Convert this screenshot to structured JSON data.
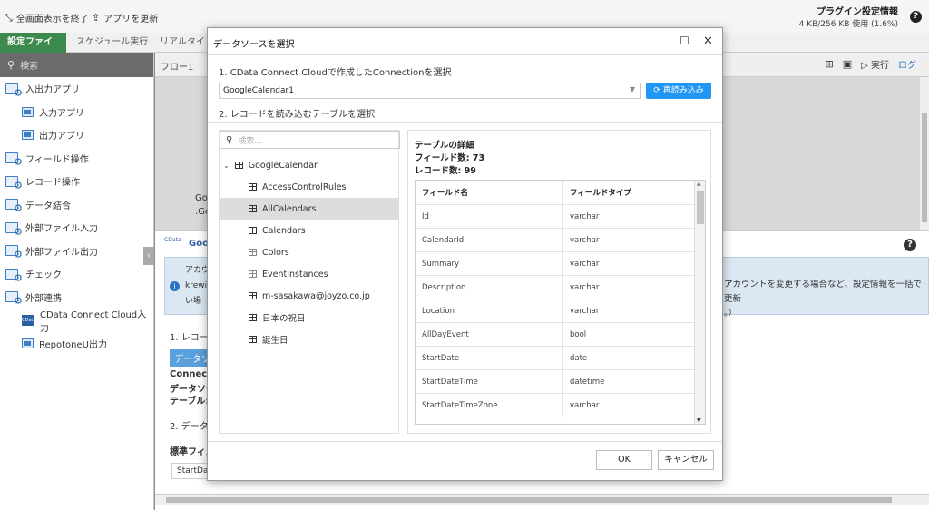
{
  "topbar": {
    "fullscreen_exit": "全画面表示を終了",
    "update_app": "アプリを更新",
    "plugin_title": "プラグイン設定情報",
    "plugin_usage": "4 KB/256 KB 使用 (1.6%)"
  },
  "tabs": [
    {
      "label": "設定ファイル"
    },
    {
      "label": "スケジュール実行"
    },
    {
      "label": "リアルタイム"
    }
  ],
  "sidebar": {
    "search_placeholder": "検索",
    "items": [
      {
        "label": "入出力アプリ",
        "kind": "group"
      },
      {
        "label": "入力アプリ",
        "kind": "app"
      },
      {
        "label": "出力アプリ",
        "kind": "app"
      },
      {
        "label": "フィールド操作",
        "kind": "group"
      },
      {
        "label": "レコード操作",
        "kind": "group"
      },
      {
        "label": "データ結合",
        "kind": "group"
      },
      {
        "label": "外部ファイル入力",
        "kind": "group"
      },
      {
        "label": "外部ファイル出力",
        "kind": "group"
      },
      {
        "label": "チェック",
        "kind": "group"
      },
      {
        "label": "外部連携",
        "kind": "group"
      },
      {
        "label": "CData Connect Cloud入力",
        "kind": "cdata"
      },
      {
        "label": "RepotoneU出力",
        "kind": "repo"
      }
    ]
  },
  "main": {
    "flow_label": "フロー1",
    "run_label": "実行",
    "log_label": "ログ",
    "frag_go1": "Go",
    "frag_go2": ".Go",
    "cdata_logo": "CData",
    "frag_goo": "Goo",
    "frag_acct": "アカウ",
    "frag_krew": "krewi",
    "frag_iba": "い場",
    "frag_step1": "1. レコー",
    "frag_ds": "データソ",
    "frag_conn": "Connectio",
    "frag_dsrc": "データソー",
    "frag_table": "テーブル:",
    "frag_step2": "2. データ",
    "frag_std": "標準フィル",
    "frag_startdate": "StartDa",
    "info_line1": "アカウントを変更する場合など、設定情報を一括で更新",
    "info_line2": "。）"
  },
  "dialog": {
    "title": "データソースを選択",
    "step1": "1. CData Connect Cloudで作成したConnectionを選択",
    "connection_value": "GoogleCalendar1",
    "reload_label": "再読み込み",
    "step2": "2. レコードを読み込むテーブルを選択",
    "search_placeholder": "検索...",
    "tree_root": "GoogleCalendar",
    "tree_items": [
      {
        "label": "AccessControlRules",
        "selected": false,
        "icon": "table-icon"
      },
      {
        "label": "AllCalendars",
        "selected": true,
        "icon": "table-icon"
      },
      {
        "label": "Calendars",
        "selected": false,
        "icon": "table-icon"
      },
      {
        "label": "Colors",
        "selected": false,
        "icon": "view-icon"
      },
      {
        "label": "EventInstances",
        "selected": false,
        "icon": "view-icon"
      },
      {
        "label": "m-sasakawa@joyzo.co.jp",
        "selected": false,
        "icon": "table-icon"
      },
      {
        "label": "日本の祝日",
        "selected": false,
        "icon": "table-icon"
      },
      {
        "label": "誕生日",
        "selected": false,
        "icon": "table-icon"
      }
    ],
    "detail_title": "テーブルの詳細",
    "field_count": "フィールド数: 73",
    "record_count": "レコード数: 99",
    "columns": [
      "フィールド名",
      "フィールドタイプ"
    ],
    "fields": [
      [
        "Id",
        "varchar"
      ],
      [
        "CalendarId",
        "varchar"
      ],
      [
        "Summary",
        "varchar"
      ],
      [
        "Description",
        "varchar"
      ],
      [
        "Location",
        "varchar"
      ],
      [
        "AllDayEvent",
        "bool"
      ],
      [
        "StartDate",
        "date"
      ],
      [
        "StartDateTime",
        "datetime"
      ],
      [
        "StartDateTimeZone",
        "varchar"
      ]
    ],
    "ok_label": "OK",
    "cancel_label": "キャンセル"
  }
}
